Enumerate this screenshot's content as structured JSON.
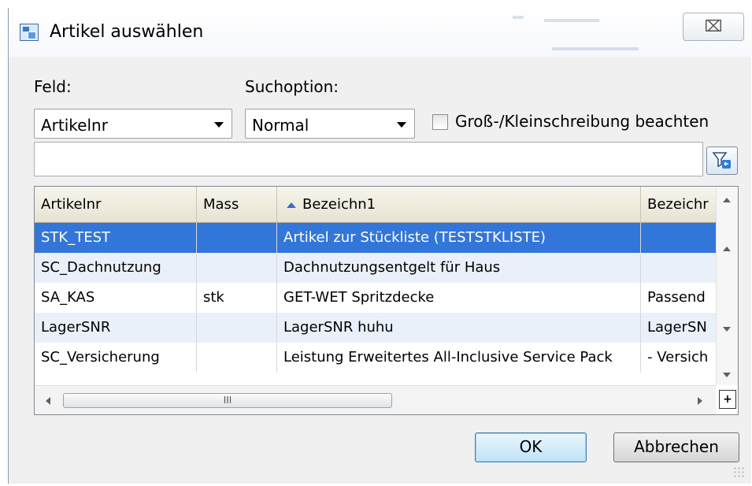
{
  "window": {
    "title": "Artikel auswählen",
    "close_glyph": "⌧"
  },
  "form": {
    "feld_label": "Feld:",
    "suchoption_label": "Suchoption:",
    "feld_value": "Artikelnr",
    "suchoption_value": "Normal",
    "case_checkbox_label": "Groß-/Kleinschreibung beachten",
    "case_checked": false,
    "search_value": "",
    "search_placeholder": ""
  },
  "grid": {
    "columns": [
      {
        "label": "Artikelnr"
      },
      {
        "label": "Mass"
      },
      {
        "label": "Bezeichn1",
        "sorted": "ascending"
      },
      {
        "label": "Bezeichr"
      }
    ],
    "rows": [
      {
        "cells": [
          "STK_TEST",
          "",
          "Artikel zur Stückliste (TESTSTKLISTE)",
          ""
        ],
        "selected": true
      },
      {
        "cells": [
          "SC_Dachnutzung",
          "",
          "Dachnutzungsentgelt für Haus",
          ""
        ],
        "selected": false
      },
      {
        "cells": [
          "SA_KAS",
          "stk",
          "GET-WET Spritzdecke",
          "Passend"
        ],
        "selected": false
      },
      {
        "cells": [
          "LagerSNR",
          "",
          "LagerSNR huhu",
          "LagerSN"
        ],
        "selected": false
      },
      {
        "cells": [
          "SC_Versicherung",
          "",
          "Leistung Erweitertes All-Inclusive Service Pack",
          "- Versich"
        ],
        "selected": false
      }
    ],
    "hscroll_thumb_label": "III",
    "expand_label": "+−"
  },
  "buttons": {
    "ok": "OK",
    "cancel": "Abbrechen"
  },
  "colors": {
    "selection": "#3376d9",
    "alt_row": "#eaf0fa",
    "header": "#ece9d8"
  }
}
